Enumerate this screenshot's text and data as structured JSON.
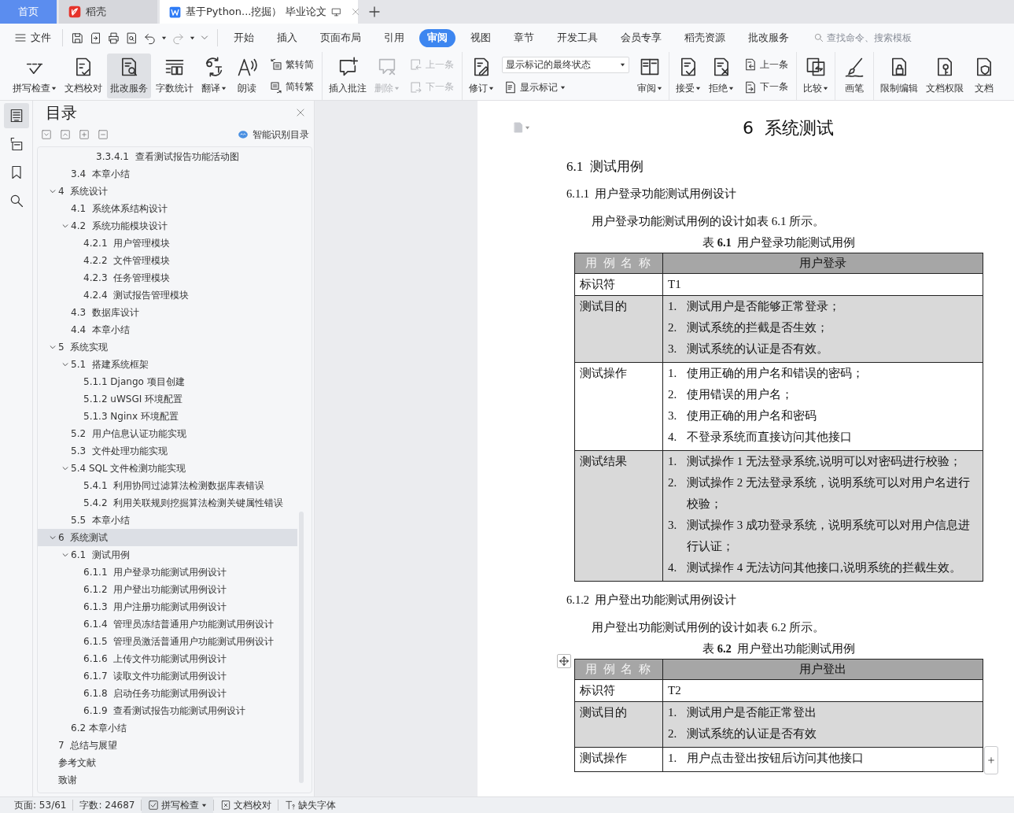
{
  "tabs": [
    {
      "label": "首页",
      "kind": "home",
      "selected": false
    },
    {
      "label": "稻壳",
      "kind": "app",
      "selected": false
    },
    {
      "label": "基于Python...挖掘） 毕业论文",
      "kind": "doc",
      "selected": true
    }
  ],
  "menu": {
    "file": "文件",
    "tabs": [
      {
        "label": "开始",
        "selected": false
      },
      {
        "label": "插入",
        "selected": false
      },
      {
        "label": "页面布局",
        "selected": false
      },
      {
        "label": "引用",
        "selected": false
      },
      {
        "label": "审阅",
        "selected": true
      },
      {
        "label": "视图",
        "selected": false
      },
      {
        "label": "章节",
        "selected": false
      },
      {
        "label": "开发工具",
        "selected": false
      },
      {
        "label": "会员专享",
        "selected": false
      },
      {
        "label": "稻壳资源",
        "selected": false
      },
      {
        "label": "批改服务",
        "selected": false
      }
    ],
    "search": {
      "placeholder": "查找命令、搜索模板"
    }
  },
  "ribbon": [
    [
      {
        "kind": "big",
        "label": "拼写检查",
        "dropdown": true,
        "disabled": false,
        "selected": false
      },
      {
        "kind": "big",
        "label": "文档校对",
        "dropdown": false,
        "disabled": false,
        "selected": false
      },
      {
        "kind": "big",
        "label": "批改服务",
        "dropdown": false,
        "disabled": false,
        "selected": true
      },
      {
        "kind": "big",
        "label": "字数统计",
        "dropdown": false,
        "disabled": false,
        "selected": false
      },
      {
        "kind": "big",
        "label": "翻译",
        "dropdown": true,
        "disabled": false,
        "selected": false
      },
      {
        "kind": "big",
        "label": "朗读",
        "dropdown": false,
        "disabled": false,
        "selected": false
      },
      {
        "kind": "pair",
        "items": [
          {
            "label": "繁转简",
            "disabled": false
          },
          {
            "label": "简转繁",
            "disabled": false
          }
        ]
      }
    ],
    [
      {
        "kind": "big",
        "label": "插入批注",
        "dropdown": false,
        "disabled": false,
        "selected": false
      },
      {
        "kind": "big",
        "label": "删除",
        "dropdown": true,
        "disabled": true,
        "selected": false
      },
      {
        "kind": "pair",
        "items": [
          {
            "label": "上一条",
            "disabled": true
          },
          {
            "label": "下一条",
            "disabled": true
          }
        ]
      }
    ],
    [
      {
        "kind": "big",
        "label": "修订",
        "dropdown": true,
        "disabled": false,
        "selected": false
      },
      {
        "kind": "select",
        "value": "显示标记的最终状态",
        "button": "显示标记"
      },
      {
        "kind": "big",
        "label": "审阅",
        "dropdown": true,
        "disabled": false,
        "selected": false
      }
    ],
    [
      {
        "kind": "big",
        "label": "接受",
        "dropdown": true,
        "disabled": false,
        "selected": false
      },
      {
        "kind": "big",
        "label": "拒绝",
        "dropdown": true,
        "disabled": false,
        "selected": false
      },
      {
        "kind": "pair",
        "items": [
          {
            "label": "上一条",
            "disabled": false
          },
          {
            "label": "下一条",
            "disabled": false
          }
        ]
      }
    ],
    [
      {
        "kind": "big",
        "label": "比较",
        "dropdown": true,
        "disabled": false,
        "selected": false
      }
    ],
    [
      {
        "kind": "big",
        "label": "画笔",
        "dropdown": false,
        "disabled": false,
        "selected": false
      }
    ],
    [
      {
        "kind": "big",
        "label": "限制编辑",
        "dropdown": false,
        "disabled": false,
        "selected": false
      },
      {
        "kind": "big",
        "label": "文档权限",
        "dropdown": false,
        "disabled": false,
        "selected": false
      },
      {
        "kind": "big",
        "label": "文档",
        "dropdown": false,
        "disabled": false,
        "selected": false
      }
    ]
  ],
  "side_rail": [
    {
      "selected": true
    },
    {
      "selected": false
    },
    {
      "selected": false
    },
    {
      "selected": false
    }
  ],
  "toc": {
    "title": "目录",
    "smart_button": "智能识别目录",
    "items": [
      {
        "children": [
          {
            "children": [
              {
                "children": [
                  {
                    "label": "3.3.4.1  查看测试报告功能活动图",
                    "selected": false
                  }
                ]
              }
            ]
          },
          {
            "label": "3.4  本章小结",
            "selected": false
          }
        ]
      },
      {
        "label": "4  系统设计",
        "selected": false,
        "expanded": true,
        "children": [
          {
            "label": "4.1  系统体系结构设计",
            "selected": false
          },
          {
            "label": "4.2  系统功能模块设计",
            "selected": false,
            "expanded": true,
            "children": [
              {
                "label": "4.2.1  用户管理模块",
                "selected": false
              },
              {
                "label": "4.2.2  文件管理模块",
                "selected": false
              },
              {
                "label": "4.2.3  任务管理模块",
                "selected": false
              },
              {
                "label": "4.2.4  测试报告管理模块",
                "selected": false
              }
            ]
          },
          {
            "label": "4.3  数据库设计",
            "selected": false
          },
          {
            "label": "4.4  本章小结",
            "selected": false
          }
        ]
      },
      {
        "label": "5  系统实现",
        "selected": false,
        "expanded": true,
        "children": [
          {
            "label": "5.1  搭建系统框架",
            "selected": false,
            "expanded": true,
            "children": [
              {
                "label": "5.1.1 Django 项目创建",
                "selected": false
              },
              {
                "label": "5.1.2 uWSGI 环境配置",
                "selected": false
              },
              {
                "label": "5.1.3 Nginx 环境配置",
                "selected": false
              }
            ]
          },
          {
            "label": "5.2  用户信息认证功能实现",
            "selected": false
          },
          {
            "label": "5.3  文件处理功能实现",
            "selected": false
          },
          {
            "label": "5.4 SQL 文件检测功能实现",
            "selected": false,
            "expanded": true,
            "children": [
              {
                "label": "5.4.1  利用协同过滤算法检测数据库表错误",
                "selected": false
              },
              {
                "label": "5.4.2  利用关联规则挖掘算法检测关键属性错误",
                "selected": false
              }
            ]
          },
          {
            "label": "5.5  本章小结",
            "selected": false
          }
        ]
      },
      {
        "label": "6  系统测试",
        "selected": true,
        "expanded": true,
        "children": [
          {
            "label": "6.1  测试用例",
            "selected": false,
            "expanded": true,
            "children": [
              {
                "label": "6.1.1  用户登录功能测试用例设计",
                "selected": false
              },
              {
                "label": "6.1.2  用户登出功能测试用例设计",
                "selected": false
              },
              {
                "label": "6.1.3  用户注册功能测试用例设计",
                "selected": false
              },
              {
                "label": "6.1.4  管理员冻结普通用户功能测试用例设计",
                "selected": false
              },
              {
                "label": "6.1.5  管理员激活普通用户功能测试用例设计",
                "selected": false
              },
              {
                "label": "6.1.6  上传文件功能测试用例设计",
                "selected": false
              },
              {
                "label": "6.1.7  读取文件功能测试用例设计",
                "selected": false
              },
              {
                "label": "6.1.8  启动任务功能测试用例设计",
                "selected": false
              },
              {
                "label": "6.1.9  查看测试报告功能测试用例设计",
                "selected": false
              }
            ]
          },
          {
            "label": "6.2 本章小结",
            "selected": false
          }
        ]
      },
      {
        "label": "7  总结与展望",
        "selected": false
      },
      {
        "label": "参考文献",
        "selected": false
      },
      {
        "label": "致谢",
        "selected": false
      }
    ]
  },
  "document": [
    {
      "kind": "heading1",
      "text": "6  系统测试"
    },
    {
      "kind": "heading2",
      "text": "6.1  测试用例"
    },
    {
      "kind": "heading3",
      "text": "6.1.1  用户登录功能测试用例设计"
    },
    {
      "kind": "paragraph",
      "text": "用户登录功能测试用例的设计如表 6.1 所示。"
    },
    {
      "kind": "caption",
      "text": "表 **6.1**  用户登录功能测试用例"
    },
    {
      "kind": "table",
      "header": [
        "用 例 名 称",
        "用户登录"
      ],
      "rows": [
        {
          "label": "标识符",
          "value": "T1",
          "shaded": false
        },
        {
          "label": "测试目的",
          "shaded": true,
          "items": [
            {
              "number": "1.",
              "text": "测试用户是否能够正常登录；"
            },
            {
              "number": "2.",
              "text": "测试系统的拦截是否生效；"
            },
            {
              "number": "3.",
              "text": "测试系统的认证是否有效。"
            }
          ]
        },
        {
          "label": "测试操作",
          "shaded": false,
          "items": [
            {
              "number": "1.",
              "text": "使用正确的用户名和错误的密码；"
            },
            {
              "number": "2.",
              "text": "使用错误的用户名；"
            },
            {
              "number": "3.",
              "text": "使用正确的用户名和密码"
            },
            {
              "number": "4.",
              "text": "不登录系统而直接访问其他接口"
            }
          ]
        },
        {
          "label": "测试结果",
          "shaded": true,
          "items": [
            {
              "number": "1.",
              "text": "测试操作 1 无法登录系统,说明可以对密码进行校验；"
            },
            {
              "number": "2.",
              "text": "测试操作 2 无法登录系统，说明系统可以对用户名进行校验；"
            },
            {
              "number": "3.",
              "text": "测试操作 3 成功登录系统，说明系统可以对用户信息进行认证；"
            },
            {
              "number": "4.",
              "text": "测试操作 4 无法访问其他接口,说明系统的拦截生效。"
            }
          ]
        }
      ]
    },
    {
      "kind": "heading3",
      "text": "6.1.2  用户登出功能测试用例设计"
    },
    {
      "kind": "paragraph",
      "text": "用户登出功能测试用例的设计如表 6.2 所示。"
    },
    {
      "kind": "caption",
      "text": "表 **6.2**  用户登出功能测试用例"
    },
    {
      "kind": "table",
      "header": [
        "用 例 名 称",
        "用户登出"
      ],
      "rows": [
        {
          "label": "标识符",
          "value": "T2",
          "shaded": false
        },
        {
          "label": "测试目的",
          "shaded": true,
          "items": [
            {
              "number": "1.",
              "text": "测试用户是否能正常登出"
            },
            {
              "number": "2.",
              "text": "测试系统的认证是否有效"
            }
          ]
        },
        {
          "label": "测试操作",
          "shaded": false,
          "items": [
            {
              "number": "1.",
              "text": "用户点击登出按钮后访问其他接口"
            }
          ]
        }
      ]
    }
  ],
  "status_bar": [
    {
      "kind": "text",
      "label": "页面: 53/61"
    },
    {
      "kind": "text",
      "label": "字数: 24687"
    },
    {
      "kind": "spell",
      "label": "拼写检查",
      "dropdown": true
    },
    {
      "kind": "proof",
      "label": "文档校对",
      "dropdown": false
    },
    {
      "kind": "font",
      "label": "缺失字体",
      "dropdown": false
    }
  ]
}
